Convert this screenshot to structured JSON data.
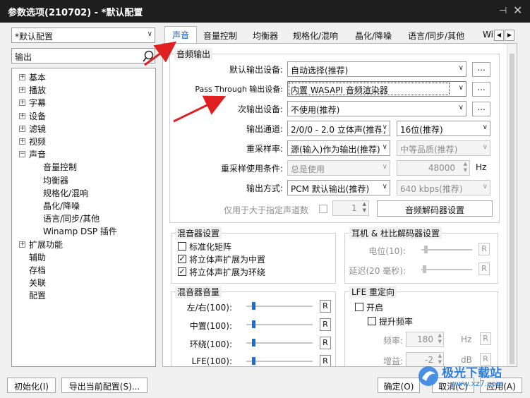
{
  "window": {
    "title": "参数选项(210702) - *默认配置",
    "pin_glyph": "⊣",
    "close_glyph": "✕"
  },
  "left": {
    "profile_combo": "*默认配置",
    "search_value": "输出",
    "tree": [
      "基本",
      "播放",
      "字幕",
      "设备",
      "滤镜",
      "视频",
      "声音",
      "音量控制",
      "均衡器",
      "规格化/混响",
      "晶化/降噪",
      "语言/同步/其他",
      "Winamp DSP 插件",
      "扩展功能",
      "辅助",
      "存档",
      "关联",
      "配置"
    ]
  },
  "tabs": [
    "声音",
    "音量控制",
    "均衡器",
    "规格化/混响",
    "晶化/降噪",
    "语言/同步/其他",
    "Wi"
  ],
  "audio_output": {
    "group_title": "音频输出",
    "default_device_label": "默认输出设备:",
    "default_device_value": "自动选择(推荐)",
    "passthrough_label": "Pass Through 输出设备:",
    "passthrough_value": "内置 WASAPI 音频渲染器",
    "secondary_label": "次输出设备:",
    "secondary_value": "不使用(推荐)",
    "more_btn": "...",
    "channel_label": "输出通道:",
    "channel_value": "2/0/0 - 2.0 立体声(推荐)",
    "bits_value": "16位(推荐)",
    "resample_label": "重采样率:",
    "resample_value": "源(输入)作为输出(推荐)",
    "quality_value": "中等品质(推荐)",
    "resample_cond_label": "重采样使用条件:",
    "resample_cond_value": "总是使用",
    "hz_value": "48000",
    "hz_unit": "Hz",
    "output_mode_label": "输出方式:",
    "output_mode_value": "PCM 默认输出(推荐)",
    "bitrate_value": "640 kbps(推荐)",
    "channels_only_label": "仅用于大于指定声道数",
    "channels_spin": "1",
    "decoder_btn": "音频解码器设置"
  },
  "mixer": {
    "group_title": "混音器设置",
    "items": [
      {
        "label": "标准化矩阵",
        "checked": false
      },
      {
        "label": "将立体声扩展为中置",
        "checked": true
      },
      {
        "label": "将立体声扩展为环绕",
        "checked": true
      }
    ]
  },
  "headphone": {
    "group_title": "耳机 & 杜比解码器设置",
    "level_label": "电位(10):",
    "delay_label": "延迟(20 毫秒):",
    "r": "R"
  },
  "mixer_volume": {
    "group_title": "混音器音量",
    "rows": [
      "左/右(100):",
      "中置(100):",
      "环绕(100):",
      "LFE(100):"
    ],
    "r": "R"
  },
  "lfe": {
    "group_title": "LFE 重定向",
    "enable": "开启",
    "boost": "提升频率",
    "freq_label": "频率:",
    "freq_value": "180",
    "freq_unit": "Hz",
    "gain_label": "增益:",
    "gain_value": "-2",
    "gain_unit": "dB",
    "r": "R"
  },
  "bottom": {
    "init_btn": "初始化(I)",
    "export_btn": "导出当前配置(S)...",
    "ok_btn": "确定(O)",
    "cancel_btn": "取消(C)",
    "apply_btn": "应用(A)"
  },
  "watermark": {
    "line1": "极光下载站",
    "line2": "www.xz7.com"
  },
  "colors": {
    "accent": "#1e5fb3",
    "arrow": "#e02020",
    "slider": "#1a6fd6"
  }
}
